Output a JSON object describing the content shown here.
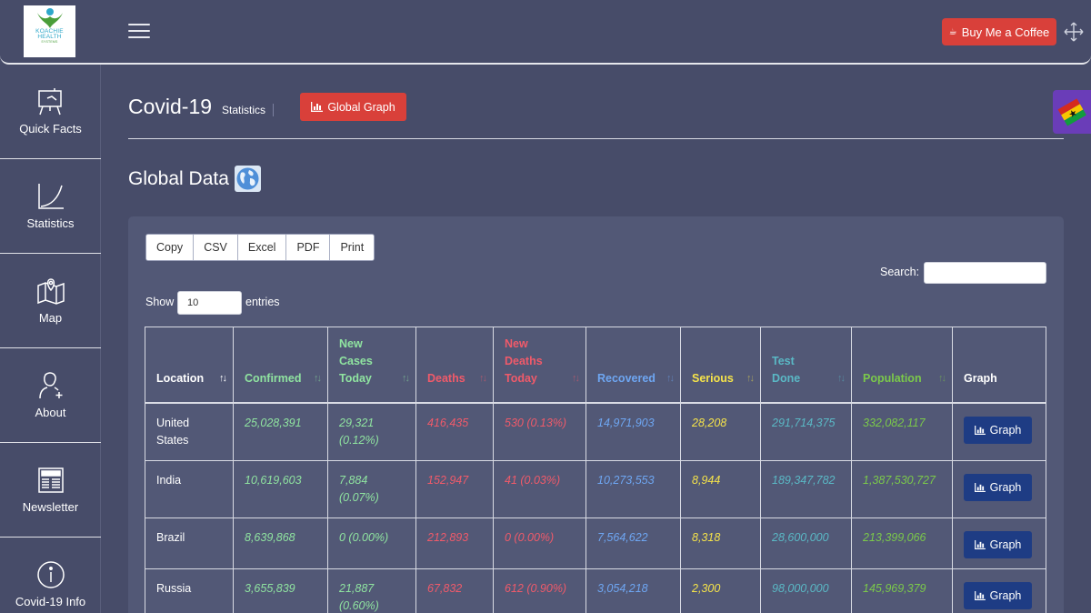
{
  "logo": {
    "line1": "KOACHIE",
    "line2": "HEALTH",
    "line3": "SYSTEMS"
  },
  "topbar": {
    "coffee_label": "Buy Me a Coffee"
  },
  "sidebar": {
    "items": [
      {
        "label": "Quick Facts",
        "icon": "presentation-board-icon"
      },
      {
        "label": "Statistics",
        "icon": "chart-curve-icon"
      },
      {
        "label": "Map",
        "icon": "map-pin-icon"
      },
      {
        "label": "About",
        "icon": "user-add-icon"
      },
      {
        "label": "Newsletter",
        "icon": "newspaper-icon"
      },
      {
        "label": "Covid-19 Info",
        "icon": "info-circle-icon"
      }
    ]
  },
  "header": {
    "title": "Covid-19",
    "subtitle": "Statistics",
    "global_graph_label": "Global Graph"
  },
  "section": {
    "title": "Global Data"
  },
  "toolbar": {
    "buttons": [
      "Copy",
      "CSV",
      "Excel",
      "PDF",
      "Print"
    ]
  },
  "search": {
    "label": "Search:",
    "value": ""
  },
  "length": {
    "show": "Show",
    "value": "10",
    "entries": "entries"
  },
  "table": {
    "headers": [
      "Location",
      "Confirmed",
      "New Cases Today",
      "Deaths",
      "New Deaths Today",
      "Recovered",
      "Serious",
      "Test Done",
      "Population",
      "Graph"
    ],
    "graph_label": "Graph",
    "rows": [
      {
        "location": "United States",
        "confirmed": "25,028,391",
        "new_cases": "29,321 (0.12%)",
        "deaths": "416,435",
        "new_deaths": "530 (0.13%)",
        "recovered": "14,971,903",
        "serious": "28,208",
        "tests": "291,714,375",
        "population": "332,082,117"
      },
      {
        "location": "India",
        "confirmed": "10,619,603",
        "new_cases": "7,884 (0.07%)",
        "deaths": "152,947",
        "new_deaths": "41 (0.03%)",
        "recovered": "10,273,553",
        "serious": "8,944",
        "tests": "189,347,782",
        "population": "1,387,530,727"
      },
      {
        "location": "Brazil",
        "confirmed": "8,639,868",
        "new_cases": "0 (0.00%)",
        "deaths": "212,893",
        "new_deaths": "0 (0.00%)",
        "recovered": "7,564,622",
        "serious": "8,318",
        "tests": "28,600,000",
        "population": "213,399,066"
      },
      {
        "location": "Russia",
        "confirmed": "3,655,839",
        "new_cases": "21,887 (0.60%)",
        "deaths": "67,832",
        "new_deaths": "612 (0.90%)",
        "recovered": "3,054,218",
        "serious": "2,300",
        "tests": "98,000,000",
        "population": "145,969,379"
      }
    ]
  },
  "colors": {
    "background": "#474c69",
    "card": "#525876",
    "accent_red": "#d9403a",
    "graph_button": "#1e3c84",
    "confirmed": "#8fe3a0",
    "deaths": "#f05a6a",
    "recovered": "#6ea6f2",
    "serious": "#f5e34a",
    "tests": "#5ab8c5",
    "population": "#7bc94a"
  }
}
